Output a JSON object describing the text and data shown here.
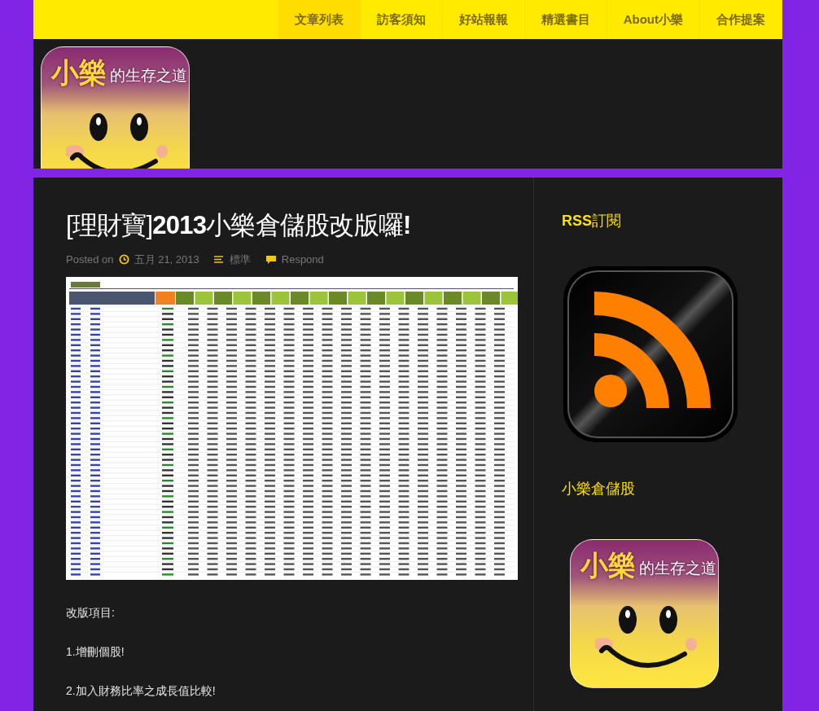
{
  "nav": {
    "items": [
      {
        "label": "文章列表",
        "selected": true
      },
      {
        "label": "訪客須知",
        "selected": false
      },
      {
        "label": "好站報報",
        "selected": false
      },
      {
        "label": "精選書目",
        "selected": false
      },
      {
        "label": "About小樂",
        "selected": false
      },
      {
        "label": "合作提案",
        "selected": false
      }
    ]
  },
  "header": {
    "logo": {
      "name": "小樂",
      "tagline": "的生存之道"
    }
  },
  "post": {
    "title": "[理財寶]**2013**小樂倉儲股改版囉**!**",
    "meta": {
      "prefix": "Posted on",
      "date": "五月 21, 2013",
      "category": "標準",
      "comments": "Respond"
    },
    "paragraphs": [
      "改版項目:",
      "1.增刪個股!",
      "2.加入財務比率之成長值比較!"
    ]
  },
  "sidebar": {
    "widgets": [
      {
        "kind": "rss",
        "title": "**RSS**訂閱"
      },
      {
        "kind": "logo",
        "title": "小樂倉儲股",
        "logo": {
          "name": "小樂",
          "tagline": "的生存之道"
        }
      }
    ]
  }
}
